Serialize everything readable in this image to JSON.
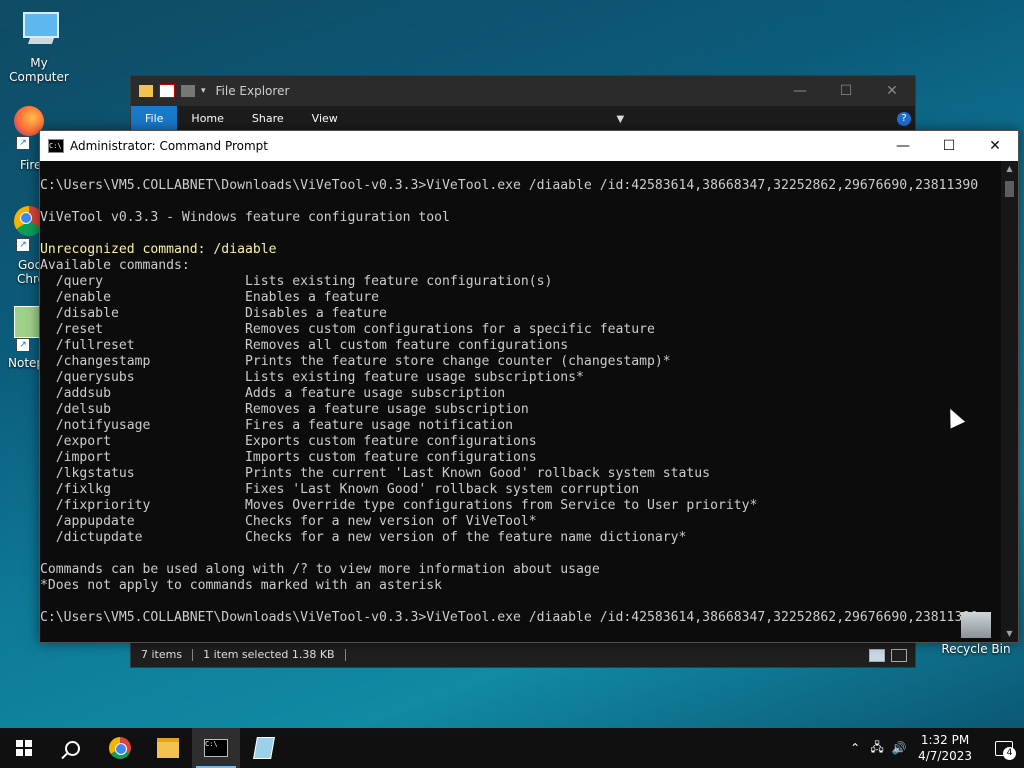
{
  "desktop": {
    "icons": {
      "my_computer": "My Computer",
      "firefox_partial": "Fire",
      "chrome_partial_1": "Goo",
      "chrome_partial_2": "Chro",
      "notepad_partial": "Notep",
      "recycle_bin": "Recycle Bin"
    }
  },
  "file_explorer": {
    "title": "File Explorer",
    "tabs": [
      "File",
      "Home",
      "Share",
      "View"
    ],
    "status": {
      "items": "7 items",
      "selected": "1 item selected  1.38 KB"
    }
  },
  "cmd": {
    "title": "Administrator: Command Prompt",
    "lines": [
      {
        "text": "C:\\Users\\VM5.COLLABNET\\Downloads\\ViVeTool-v0.3.3>ViVeTool.exe /diaable /id:42583614,38668347,32252862,29676690,23811390",
        "color": "normal"
      },
      {
        "text": "",
        "color": "normal"
      },
      {
        "text": "ViVeTool v0.3.3 - Windows feature configuration tool",
        "color": "normal"
      },
      {
        "text": "",
        "color": "normal"
      },
      {
        "text": "Unrecognized command: /diaable",
        "color": "yellow"
      },
      {
        "text": "Available commands:",
        "color": "normal"
      },
      {
        "text": "  /query                  Lists existing feature configuration(s)",
        "color": "normal"
      },
      {
        "text": "  /enable                 Enables a feature",
        "color": "normal"
      },
      {
        "text": "  /disable                Disables a feature",
        "color": "normal"
      },
      {
        "text": "  /reset                  Removes custom configurations for a specific feature",
        "color": "normal"
      },
      {
        "text": "  /fullreset              Removes all custom feature configurations",
        "color": "normal"
      },
      {
        "text": "  /changestamp            Prints the feature store change counter (changestamp)*",
        "color": "normal"
      },
      {
        "text": "  /querysubs              Lists existing feature usage subscriptions*",
        "color": "normal"
      },
      {
        "text": "  /addsub                 Adds a feature usage subscription",
        "color": "normal"
      },
      {
        "text": "  /delsub                 Removes a feature usage subscription",
        "color": "normal"
      },
      {
        "text": "  /notifyusage            Fires a feature usage notification",
        "color": "normal"
      },
      {
        "text": "  /export                 Exports custom feature configurations",
        "color": "normal"
      },
      {
        "text": "  /import                 Imports custom feature configurations",
        "color": "normal"
      },
      {
        "text": "  /lkgstatus              Prints the current 'Last Known Good' rollback system status",
        "color": "normal"
      },
      {
        "text": "  /fixlkg                 Fixes 'Last Known Good' rollback system corruption",
        "color": "normal"
      },
      {
        "text": "  /fixpriority            Moves Override type configurations from Service to User priority*",
        "color": "normal"
      },
      {
        "text": "  /appupdate              Checks for a new version of ViVeTool*",
        "color": "normal"
      },
      {
        "text": "  /dictupdate             Checks for a new version of the feature name dictionary*",
        "color": "normal"
      },
      {
        "text": "",
        "color": "normal"
      },
      {
        "text": "Commands can be used along with /? to view more information about usage",
        "color": "normal"
      },
      {
        "text": "*Does not apply to commands marked with an asterisk",
        "color": "normal"
      },
      {
        "text": "",
        "color": "normal"
      },
      {
        "text": "C:\\Users\\VM5.COLLABNET\\Downloads\\ViVeTool-v0.3.3>ViVeTool.exe /diaable /id:42583614,38668347,32252862,29676690,23811390",
        "color": "normal"
      }
    ]
  },
  "taskbar": {
    "time": "1:32 PM",
    "date": "4/7/2023",
    "notifications": "4",
    "apps": [
      "start-icon",
      "search-icon",
      "chrome-icon",
      "file-explorer-icon",
      "cmd-icon",
      "notepad-icon"
    ]
  },
  "colors": {
    "console_text": "#cccccc",
    "console_yellow": "#f9f1a5",
    "accent": "#1979ca"
  }
}
